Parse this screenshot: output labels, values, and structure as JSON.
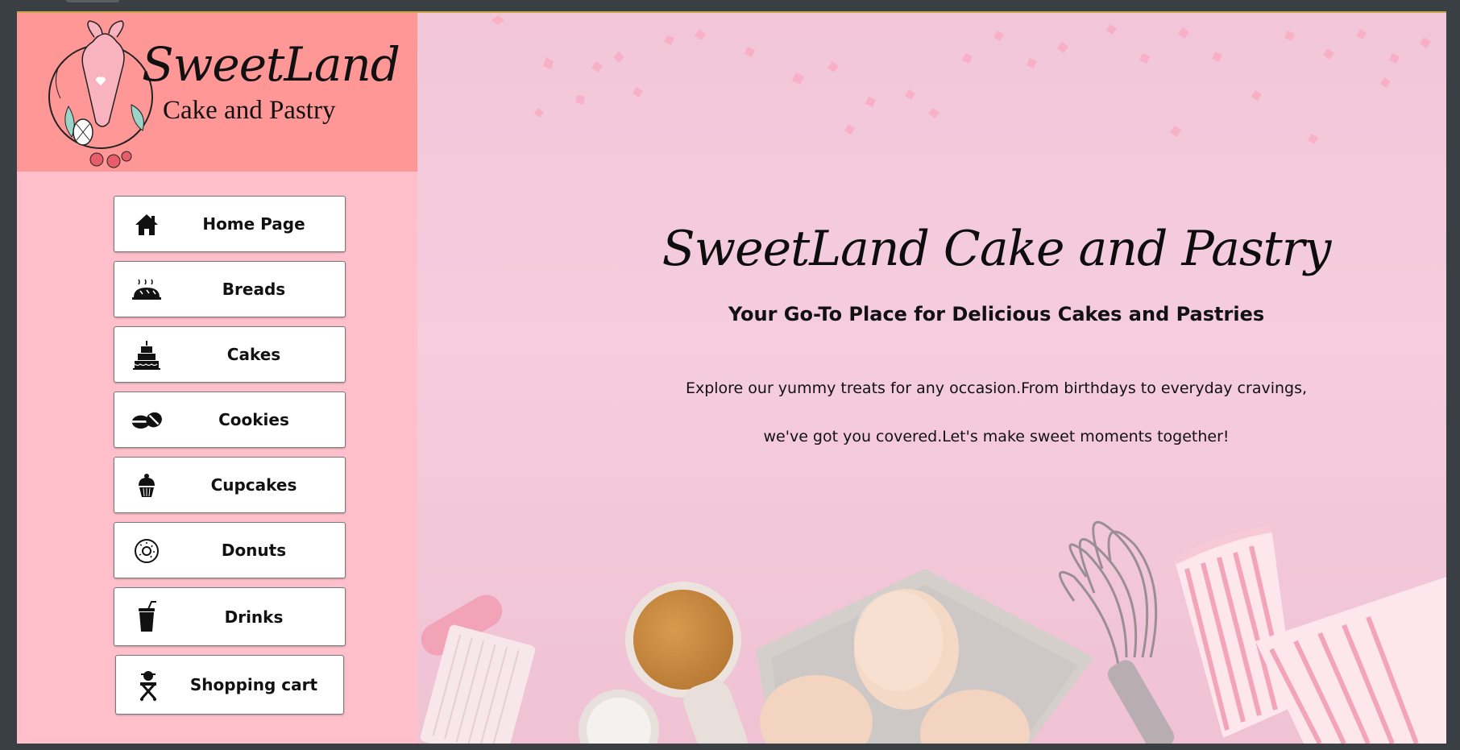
{
  "brand": {
    "name": "SweetLand",
    "tagline": "Cake and Pastry"
  },
  "nav": {
    "items": [
      {
        "label": "Home Page",
        "icon": "house-icon"
      },
      {
        "label": "Breads",
        "icon": "bread-icon"
      },
      {
        "label": "Cakes",
        "icon": "cake-icon"
      },
      {
        "label": "Cookies",
        "icon": "cookies-icon"
      },
      {
        "label": "Cupcakes",
        "icon": "cupcake-icon"
      },
      {
        "label": "Donuts",
        "icon": "donut-icon"
      },
      {
        "label": "Drinks",
        "icon": "drink-icon"
      },
      {
        "label": "Shopping cart",
        "icon": "shopping-cart-icon"
      }
    ]
  },
  "hero": {
    "title": "SweetLand Cake and Pastry",
    "subtitle": "Your Go-To Place for Delicious Cakes and Pastries",
    "line1": "Explore our yummy treats for any occasion.From birthdays to everyday cravings,",
    "line2": "we've got you covered.Let's make sweet moments together!"
  },
  "colors": {
    "sidebar": "#ffc0cb",
    "logo_background": "#ff9797",
    "hero_background": "#f2c6d8"
  }
}
